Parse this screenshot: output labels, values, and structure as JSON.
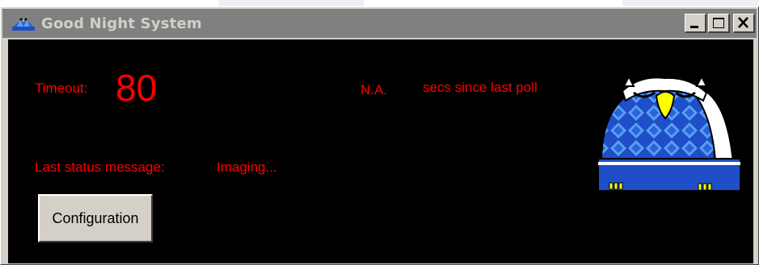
{
  "window": {
    "title": "Good Night System",
    "controls": [
      {
        "name": "minimize",
        "icon": "minimize-icon"
      },
      {
        "name": "maximize",
        "icon": "maximize-icon"
      },
      {
        "name": "close",
        "icon": "close-icon"
      }
    ]
  },
  "status": {
    "timeout_label": "Timeout:",
    "timeout_value": "80",
    "poll_value": "N.A.",
    "poll_label": "secs since last poll",
    "message_label": "Last status message:",
    "message_value": "Imaging..."
  },
  "buttons": {
    "configuration": "Configuration"
  },
  "graphic": {
    "name": "sleeping-observatory-owl",
    "icon": "observatory-owl-image"
  },
  "colors": {
    "text_red": "#ff0000",
    "client_bg": "#000000",
    "titlebar_inactive": "#808080",
    "dome_blue": "#1e4ec8",
    "dome_light_blue": "#5aa0f0",
    "beak_yellow": "#ffff00"
  }
}
